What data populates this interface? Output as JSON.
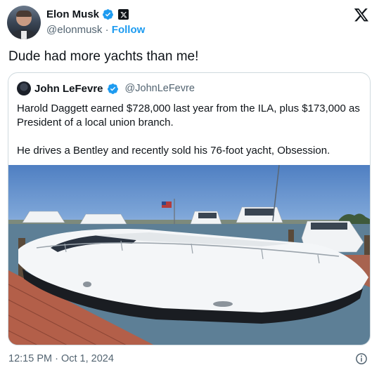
{
  "post": {
    "author": {
      "display_name": "Elon Musk",
      "handle": "@elonmusk",
      "separator": " · ",
      "follow_label": "Follow"
    },
    "text": "Dude had more yachts than me!",
    "timestamp": "12:15 PM · Oct 1, 2024"
  },
  "quote": {
    "author": {
      "display_name": "John LeFevre",
      "handle": "@JohnLeFevre"
    },
    "paragraphs": [
      "Harold Daggett earned $728,000 last year from the ILA, plus $173,000 as President of a local union branch.",
      "He drives a Bentley and recently sold his 76-foot yacht, Obsession."
    ]
  },
  "colors": {
    "accent": "#1d9bf0",
    "text_primary": "#0f1419",
    "text_secondary": "#536471",
    "border": "#cfd9de"
  },
  "icons": [
    "verified-badge-icon",
    "x-affiliation-icon",
    "x-logo-icon",
    "info-icon"
  ]
}
